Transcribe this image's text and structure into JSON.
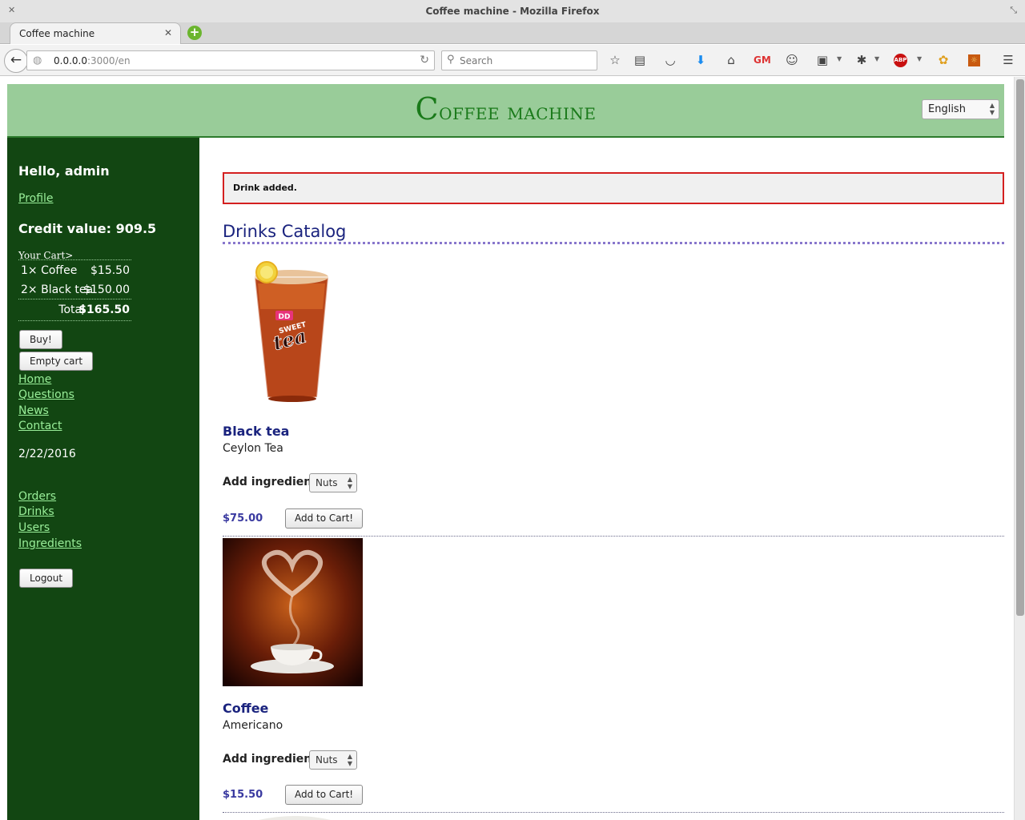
{
  "browser": {
    "window_title": "Coffee machine - Mozilla Firefox",
    "tab_label": "Coffee machine",
    "url_host": "0.0.0.0",
    "url_rest": ":3000/en",
    "search_placeholder": "Search",
    "abp_label": "ABP",
    "gm_label": "GM"
  },
  "header": {
    "title_first": "C",
    "title_rest": "offee machine",
    "language": "English"
  },
  "sidebar": {
    "greeting": "Hello, admin",
    "profile_link": "Profile",
    "credit": "Credit value: 909.5",
    "cart_caption": "Your Cart>",
    "cart_items": [
      {
        "qty_name": "1× Coffee",
        "price": "$15.50"
      },
      {
        "qty_name": "2× Black tea",
        "price": "$150.00"
      }
    ],
    "total_label": "Total",
    "total_value": "$165.50",
    "buy_button": "Buy!",
    "empty_cart_button": "Empty cart",
    "nav": [
      "Home",
      "Questions",
      "News",
      "Contact"
    ],
    "date": "2/22/2016",
    "admin_nav": [
      "Orders",
      "Drinks",
      "Users",
      "Ingredients"
    ],
    "logout_button": "Logout"
  },
  "content": {
    "flash": "Drink added.",
    "catalog_title": "Drinks Catalog",
    "ingredient_label": "Add ingredient",
    "add_to_cart_label": "Add to Cart!",
    "drinks": [
      {
        "name": "Black tea",
        "description": "Ceylon Tea",
        "ingredient": "Nuts",
        "price": "$75.00",
        "image_text": "DD SWEET tea"
      },
      {
        "name": "Coffee",
        "description": "Americano",
        "ingredient": "Nuts",
        "price": "$15.50"
      }
    ]
  },
  "colors": {
    "header_bg": "#99cc99",
    "title_green": "#1a7a1a",
    "sidebar_bg": "#124612",
    "sidebar_link": "#99ee99",
    "flash_border": "#d42020",
    "catalog_blue": "#1a237e",
    "price_blue": "#3a3aa0"
  }
}
